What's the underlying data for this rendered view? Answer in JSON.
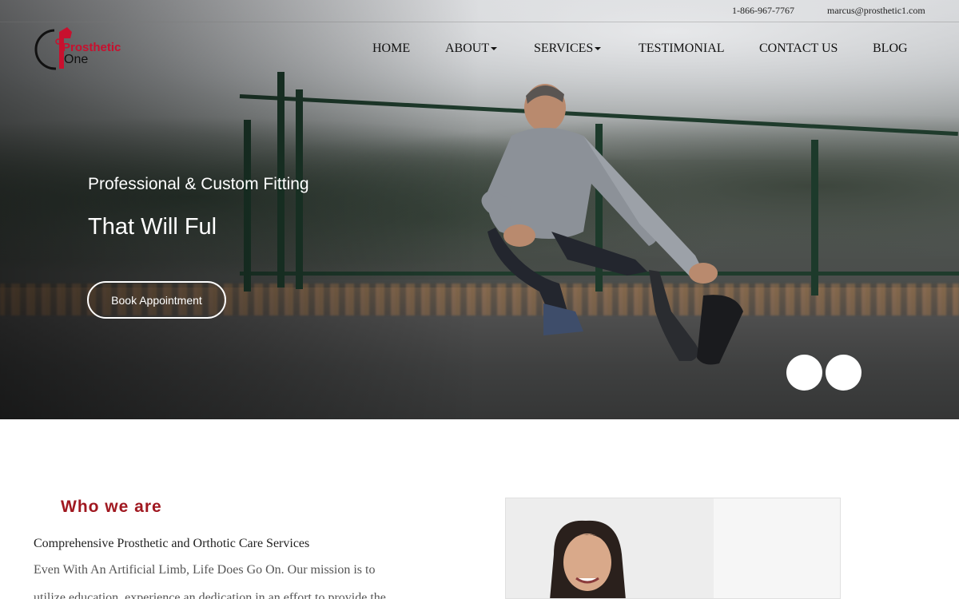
{
  "topbar": {
    "phone": "1-866-967-7767",
    "email": "marcus@prosthetic1.com"
  },
  "logo": {
    "line1": "Prosthetic",
    "line2": "One"
  },
  "nav": {
    "items": [
      {
        "label": "HOME",
        "dropdown": false
      },
      {
        "label": "ABOUT",
        "dropdown": true
      },
      {
        "label": "SERVICES",
        "dropdown": true
      },
      {
        "label": "TESTIMONIAL",
        "dropdown": false
      },
      {
        "label": "CONTACT US",
        "dropdown": false
      },
      {
        "label": "BLOG",
        "dropdown": false
      }
    ]
  },
  "hero": {
    "subtitle": "Professional & Custom Fitting",
    "title": "That Will Ful",
    "button_label": "Book Appointment"
  },
  "about": {
    "heading": "Who we are",
    "subheading": "Comprehensive Prosthetic and Orthotic Care Services",
    "body": "Even With An Artificial Limb, Life Does Go On. Our mission is to utilize education, experience an dedication in an effort to provide the"
  },
  "colors": {
    "brand_red": "#c8102e",
    "heading_red": "#a01820"
  }
}
